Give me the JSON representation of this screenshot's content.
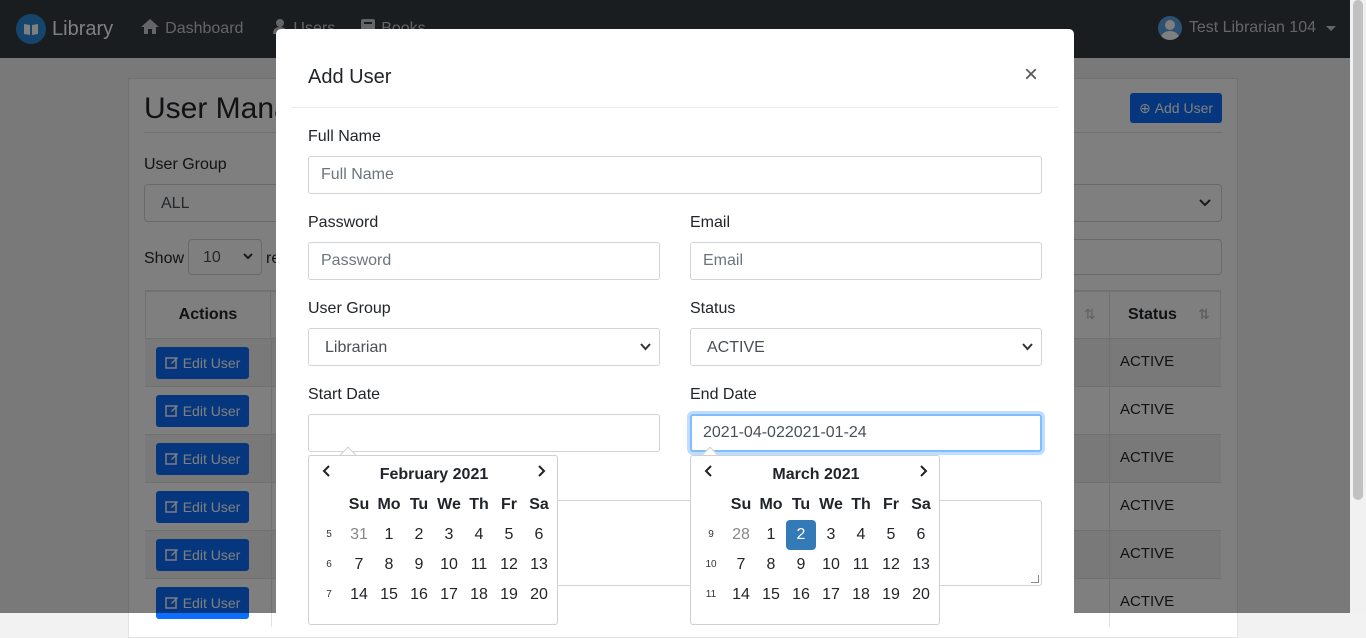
{
  "navbar": {
    "brand": "Library",
    "links": [
      "Dashboard",
      "Users",
      "Books"
    ],
    "user": "Test Librarian 104"
  },
  "page": {
    "title": "User Mana",
    "add_button": "Add User",
    "group_label": "User Group",
    "group_value": "ALL",
    "show_label": "Show",
    "show_value": "10",
    "show_after": "re",
    "col_actions": "Actions",
    "col_status": "Status",
    "rows": [
      {
        "action": "Edit User",
        "status": "ACTIVE"
      },
      {
        "action": "Edit User",
        "status": "ACTIVE"
      },
      {
        "action": "Edit User",
        "status": "ACTIVE"
      },
      {
        "action": "Edit User",
        "status": "ACTIVE"
      },
      {
        "action": "Edit User",
        "status": "ACTIVE"
      },
      {
        "action": "Edit User",
        "status": "ACTIVE"
      }
    ]
  },
  "modal": {
    "title": "Add User",
    "close": "×",
    "full_name_label": "Full Name",
    "full_name_placeholder": "Full Name",
    "password_label": "Password",
    "password_placeholder": "Password",
    "email_label": "Email",
    "email_placeholder": "Email",
    "user_group_label": "User Group",
    "user_group_value": "Librarian",
    "status_label": "Status",
    "status_value": "ACTIVE",
    "start_date_label": "Start Date",
    "start_date_value": "",
    "end_date_label": "End Date",
    "end_date_value": "2021-04-022021-01-24"
  },
  "datepickers": [
    {
      "title": "February 2021",
      "weekdays": [
        "Su",
        "Mo",
        "Tu",
        "We",
        "Th",
        "Fr",
        "Sa"
      ],
      "weeks": [
        {
          "wk": "5",
          "days": [
            "31",
            "1",
            "2",
            "3",
            "4",
            "5",
            "6"
          ],
          "old": [
            0
          ]
        },
        {
          "wk": "6",
          "days": [
            "7",
            "8",
            "9",
            "10",
            "11",
            "12",
            "13"
          ],
          "old": []
        },
        {
          "wk": "7",
          "days": [
            "14",
            "15",
            "16",
            "17",
            "18",
            "19",
            "20"
          ],
          "old": []
        }
      ],
      "active": null
    },
    {
      "title": "March 2021",
      "weekdays": [
        "Su",
        "Mo",
        "Tu",
        "We",
        "Th",
        "Fr",
        "Sa"
      ],
      "weeks": [
        {
          "wk": "9",
          "days": [
            "28",
            "1",
            "2",
            "3",
            "4",
            "5",
            "6"
          ],
          "old": [
            0
          ]
        },
        {
          "wk": "10",
          "days": [
            "7",
            "8",
            "9",
            "10",
            "11",
            "12",
            "13"
          ],
          "old": []
        },
        {
          "wk": "11",
          "days": [
            "14",
            "15",
            "16",
            "17",
            "18",
            "19",
            "20"
          ],
          "old": []
        }
      ],
      "active": [
        0,
        2
      ]
    }
  ],
  "colors": {
    "primary": "#0d6efd",
    "navbar": "#343a40",
    "datepicker_active": "#337ab7",
    "focus_border": "#80bdff"
  }
}
